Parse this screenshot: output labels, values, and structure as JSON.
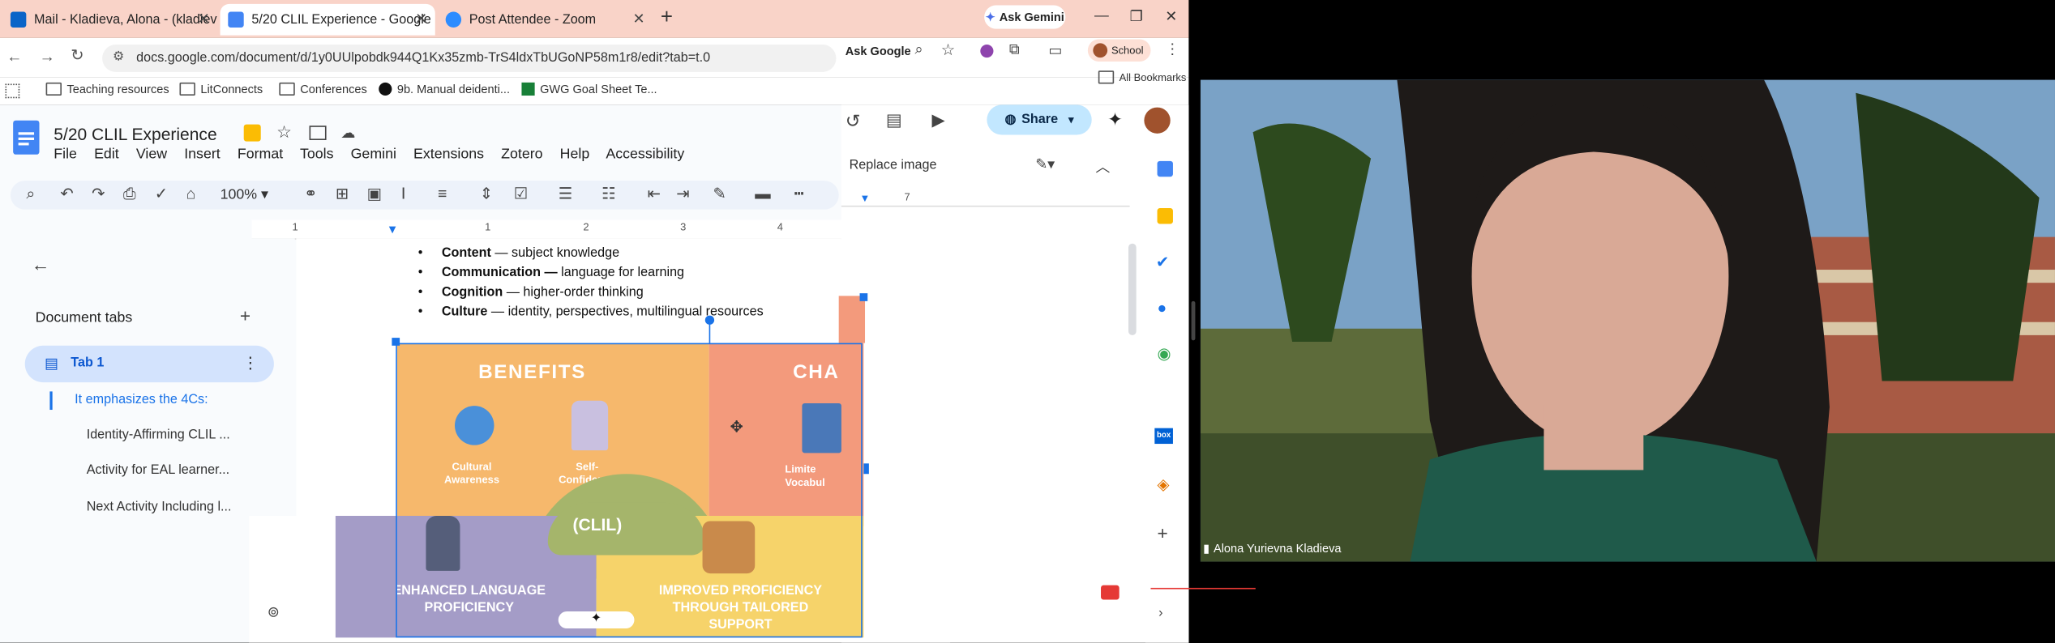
{
  "browser": {
    "tabs": [
      {
        "label": "Mail - Kladieva, Alona - (kladiev"
      },
      {
        "label": "5/20 CLIL Experience - Google"
      },
      {
        "label": "Post Attendee - Zoom"
      }
    ],
    "gemini_button": "Ask Gemini",
    "url": "docs.google.com/document/d/1y0UUlpobdk944Q1Kx35zmb-TrS4ldxTbUGoNP58m1r8/edit?tab=t.0",
    "ask_google": "Ask Google",
    "profile": "School",
    "all_bookmarks": "All Bookmarks",
    "bookmarks": [
      "Teaching resources",
      "LitConnects",
      "Conferences",
      "9b. Manual deidenti...",
      "GWG Goal Sheet Te..."
    ]
  },
  "docs": {
    "title": "5/20 CLIL Experience",
    "menu": [
      "File",
      "Edit",
      "View",
      "Insert",
      "Format",
      "Tools",
      "Gemini",
      "Extensions",
      "Zotero",
      "Help",
      "Accessibility"
    ],
    "zoom_level": "100%",
    "share": "Share",
    "replace_image": "Replace image",
    "ruler_marks": [
      "1",
      "1",
      "2",
      "3",
      "4",
      "7"
    ],
    "document_tabs_heading": "Document tabs",
    "tab_name": "Tab 1",
    "outline": [
      "It emphasizes the 4Cs:",
      "Identity-Affirming CLIL ...",
      "Activity for EAL learner...",
      "Next Activity Including l..."
    ],
    "bullets": [
      {
        "bold": "Content",
        "rest": " — subject knowledge"
      },
      {
        "bold": "Communication —",
        "rest": " language for learning"
      },
      {
        "bold": "Cognition",
        "rest": " — higher-order thinking"
      },
      {
        "bold": "Culture",
        "rest": " — identity, perspectives, multilingual resources"
      }
    ],
    "graphic": {
      "benefits": "BENEFITS",
      "challenges_partial": "CHA",
      "cultural": [
        "Cultural",
        "Awareness"
      ],
      "self": [
        "Self-",
        "Confidence"
      ],
      "limited": [
        "Limite",
        "Vocabul"
      ],
      "clil": "(CLIL)",
      "enhanced": [
        "ENHANCED LANGUAGE",
        "PROFICIENCY"
      ],
      "improved": [
        "IMPROVED PROFICIENCY",
        "THROUGH TAILORED",
        "SUPPORT"
      ]
    }
  },
  "zoom": {
    "participant": "Alona Yurievna Kladieva"
  },
  "colors": {
    "tabstrip": "#f9d3c8",
    "docs_blue": "#1a73e8",
    "share_bg": "#c2e7ff",
    "benefits_orange": "#f6b86c",
    "challenges_coral": "#f39a7c",
    "enhanced_purple": "#a49cc7",
    "improved_yellow": "#f6d36a"
  }
}
